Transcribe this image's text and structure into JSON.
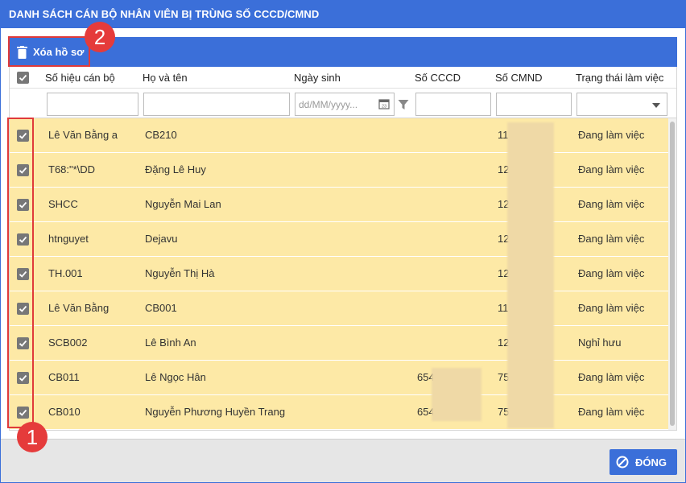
{
  "dialog": {
    "title": "DANH SÁCH CÁN BỘ NHÂN VIÊN BỊ TRÙNG SỐ CCCD/CMND"
  },
  "toolbar": {
    "delete_label": "Xóa hồ sơ"
  },
  "columns": {
    "code": "Số hiệu cán bộ",
    "name": "Họ và tên",
    "dob": "Ngày sinh",
    "cccd": "Số CCCD",
    "cmnd": "Số CMND",
    "status": "Trạng thái làm việc"
  },
  "filters": {
    "dob_placeholder": "dd/MM/yyyy..."
  },
  "rows": [
    {
      "code": "Lê Văn Bằng a",
      "name": "CB210",
      "dob": "",
      "cccd": "",
      "cmnd": "11",
      "status": "Đang làm việc"
    },
    {
      "code": "T68:\"*\\DD",
      "name": "Đặng Lê Huy",
      "dob": "",
      "cccd": "",
      "cmnd": "12",
      "status": "Đang làm việc"
    },
    {
      "code": "SHCC",
      "name": "Nguyễn Mai Lan",
      "dob": "",
      "cccd": "",
      "cmnd": "12",
      "status": "Đang làm việc"
    },
    {
      "code": "htnguyet",
      "name": "Dejavu",
      "dob": "",
      "cccd": "",
      "cmnd": "12",
      "status": "Đang làm việc"
    },
    {
      "code": "TH.001",
      "name": "Nguyễn Thị Hà",
      "dob": "",
      "cccd": "",
      "cmnd": "12",
      "status": "Đang làm việc"
    },
    {
      "code": "Lê Văn Bằng",
      "name": "CB001",
      "dob": "",
      "cccd": "",
      "cmnd": "11",
      "status": "Đang làm việc"
    },
    {
      "code": "SCB002",
      "name": "Lê Bình An",
      "dob": "",
      "cccd": "",
      "cmnd": "12",
      "status": "Nghỉ hưu"
    },
    {
      "code": "CB011",
      "name": "Lê Ngọc Hân",
      "dob": "",
      "cccd": "654",
      "cmnd": "75",
      "status": "Đang làm việc"
    },
    {
      "code": "CB010",
      "name": "Nguyễn Phương Huyền Trang",
      "dob": "",
      "cccd": "654",
      "cmnd": "75",
      "status": "Đang làm việc"
    }
  ],
  "footer": {
    "close_label": "ĐÓNG"
  },
  "annotations": {
    "badge1": "1",
    "badge2": "2"
  },
  "colors": {
    "primary": "#3b6fd9",
    "row_highlight": "#fde9a6",
    "annotation": "#e53b3b"
  }
}
